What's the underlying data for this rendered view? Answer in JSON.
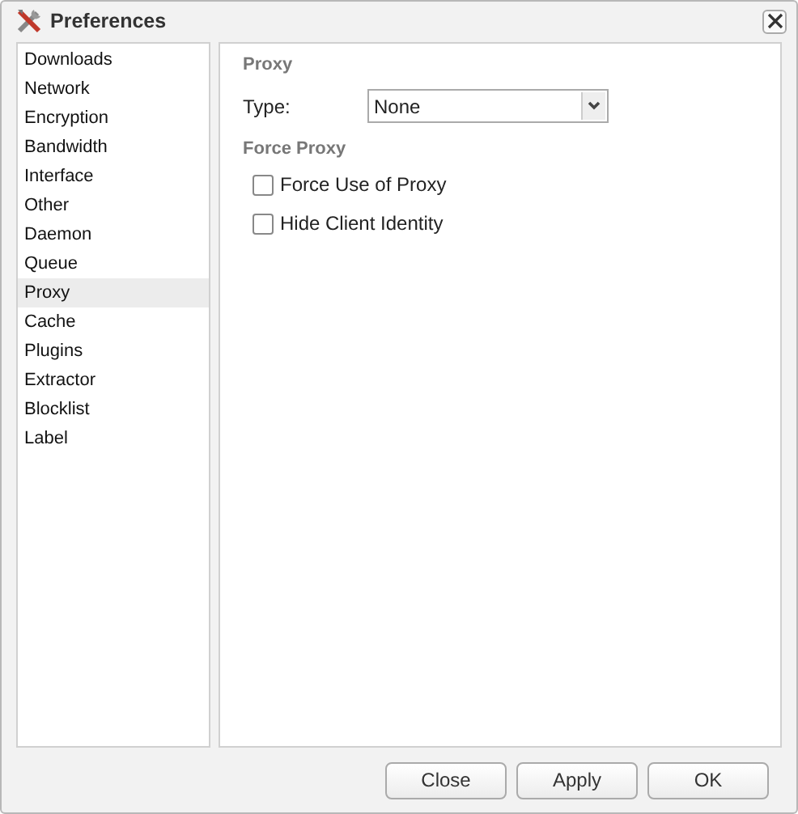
{
  "window": {
    "title": "Preferences"
  },
  "sidebar": {
    "items": [
      {
        "label": "Downloads",
        "selected": false
      },
      {
        "label": "Network",
        "selected": false
      },
      {
        "label": "Encryption",
        "selected": false
      },
      {
        "label": "Bandwidth",
        "selected": false
      },
      {
        "label": "Interface",
        "selected": false
      },
      {
        "label": "Other",
        "selected": false
      },
      {
        "label": "Daemon",
        "selected": false
      },
      {
        "label": "Queue",
        "selected": false
      },
      {
        "label": "Proxy",
        "selected": true
      },
      {
        "label": "Cache",
        "selected": false
      },
      {
        "label": "Plugins",
        "selected": false
      },
      {
        "label": "Extractor",
        "selected": false
      },
      {
        "label": "Blocklist",
        "selected": false
      },
      {
        "label": "Label",
        "selected": false
      }
    ]
  },
  "proxy": {
    "heading": "Proxy",
    "type_label": "Type:",
    "type_value": "None"
  },
  "force_proxy": {
    "heading": "Force Proxy",
    "options": [
      {
        "label": "Force Use of Proxy",
        "checked": false
      },
      {
        "label": "Hide Client Identity",
        "checked": false
      }
    ]
  },
  "buttons": [
    "Close",
    "Apply",
    "OK"
  ]
}
